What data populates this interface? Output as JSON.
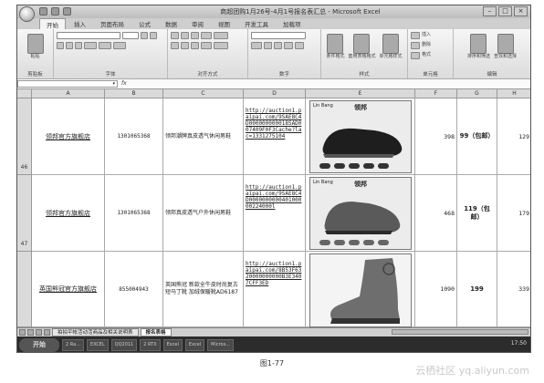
{
  "window": {
    "title": "商超团购1月26号-4月1号报名表汇总 - Microsoft Excel",
    "controls": [
      "–",
      "□",
      "×"
    ]
  },
  "ribbon": {
    "tabs": [
      "开始",
      "插入",
      "页面布局",
      "公式",
      "数据",
      "审阅",
      "视图",
      "开发工具",
      "加载项"
    ],
    "active_tab": "开始",
    "groups": {
      "clipboard": "剪贴板",
      "font": "字体",
      "alignment": "对齐方式",
      "number": "数字",
      "styles": "样式",
      "cells": "单元格",
      "editing": "编辑"
    },
    "paste_label": "粘贴",
    "styles_buttons": [
      "条件格式",
      "套用表格格式",
      "单元格样式"
    ],
    "cells_buttons": [
      "插入",
      "删除",
      "格式"
    ],
    "editing_buttons": [
      "排序和筛选",
      "查找和选择"
    ]
  },
  "formula_bar": {
    "fx": "fx"
  },
  "columns": [
    "A",
    "B",
    "C",
    "D",
    "E",
    "F",
    "G",
    "H"
  ],
  "rows": [
    {
      "row_num": "46",
      "shop": "领邦官方旗舰店",
      "id": "1301065368",
      "product": "领邦潮牌真皮透气休闲男鞋",
      "url": "http://auction1.paipai.com/9SAE8C4D000000000018SAD007409F0F3Cache?lac=1331275104",
      "img_brand": "Lin Bang",
      "img_logo": "领邦",
      "f": "398",
      "g": "99（包邮）",
      "h": "129"
    },
    {
      "row_num": "47",
      "shop": "领邦官方旗舰店",
      "id": "1301065368",
      "product": "领邦真皮透气户外休闲男鞋",
      "url": "http://auction1.paipai.com/9SAE8C4D000000000040100000224000l",
      "img_brand": "Lin Bang",
      "img_logo": "领邦",
      "f": "468",
      "g": "119（包邮）",
      "h": "179"
    },
    {
      "row_num": "",
      "shop": "英国熊冠官方旗舰店",
      "id": "855004943",
      "product": "英国熊冠 新款全牛皮时尚复古短马丁靴 加绒保暖靴AD6187",
      "url": "http://auction1.paipai.com/8B53F6320000000000B3E3407CFF3ED",
      "img_brand": "",
      "img_logo": "",
      "f": "1090",
      "g": "199",
      "h": "339"
    }
  ],
  "sheet_tabs": [
    "拍拍平帐活动活商品及相关说明表",
    "报名表格"
  ],
  "active_sheet": "报名表格",
  "taskbar": {
    "start_label": "开始",
    "items": [
      "2 Ra...",
      "EXCEL",
      "QQ2011",
      "2 RTX",
      "Excel",
      "Excel",
      "Micros..."
    ],
    "clock": "17:50"
  },
  "caption": "图1-77",
  "watermark": "云栖社区 yq.aliyun.com"
}
